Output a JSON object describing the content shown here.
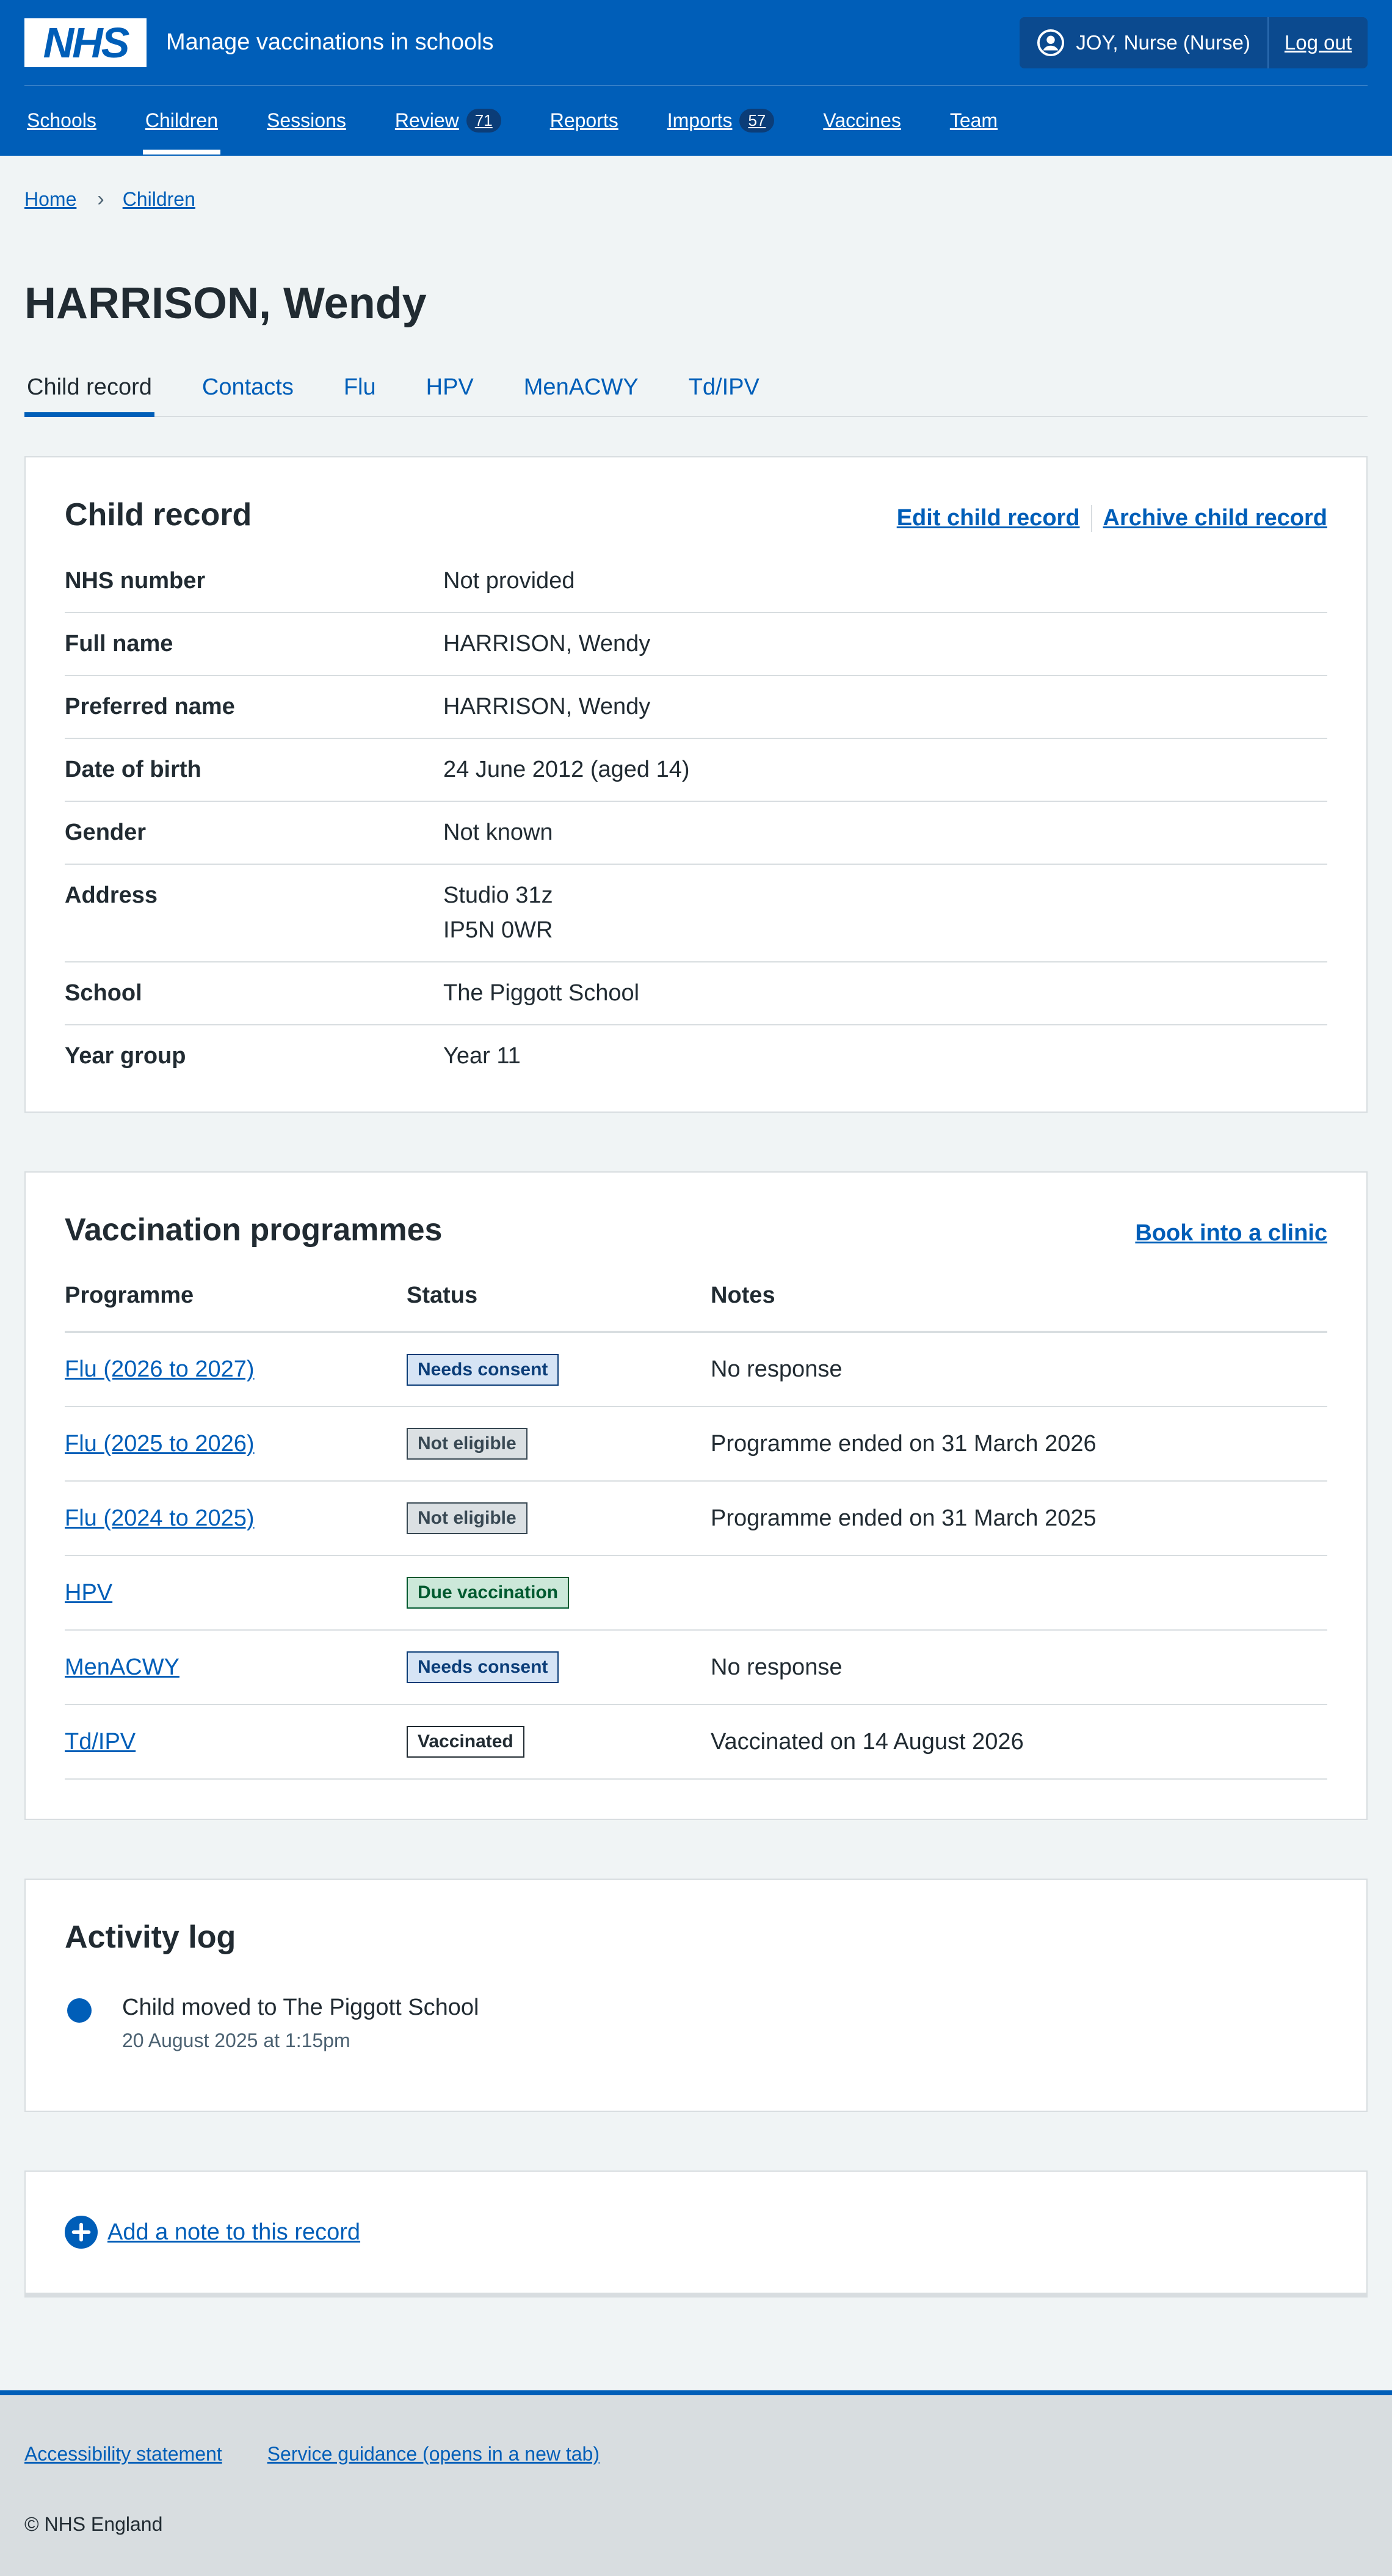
{
  "header": {
    "logo_text": "NHS",
    "service_name": "Manage vaccinations in schools",
    "user": "JOY, Nurse (Nurse)",
    "logout": "Log out"
  },
  "nav": {
    "items": [
      {
        "label": "Schools"
      },
      {
        "label": "Children",
        "active": true
      },
      {
        "label": "Sessions"
      },
      {
        "label": "Review",
        "badge": "71"
      },
      {
        "label": "Reports"
      },
      {
        "label": "Imports",
        "badge": "57"
      },
      {
        "label": "Vaccines"
      },
      {
        "label": "Team"
      }
    ]
  },
  "breadcrumb": {
    "home": "Home",
    "current": "Children"
  },
  "page_title": "HARRISON, Wendy",
  "tabs": [
    "Child record",
    "Contacts",
    "Flu",
    "HPV",
    "MenACWY",
    "Td/IPV"
  ],
  "child_record": {
    "title": "Child record",
    "edit": "Edit child record",
    "archive": "Archive child record",
    "rows": [
      {
        "key": "NHS number",
        "value": "Not provided"
      },
      {
        "key": "Full name",
        "value": "HARRISON, Wendy"
      },
      {
        "key": "Preferred name",
        "value": "HARRISON, Wendy"
      },
      {
        "key": "Date of birth",
        "value": "24 June 2012 (aged 14)"
      },
      {
        "key": "Gender",
        "value": "Not known"
      },
      {
        "key": "Address",
        "value": "Studio 31z",
        "value2": "IP5N 0WR"
      },
      {
        "key": "School",
        "value": "The Piggott School"
      },
      {
        "key": "Year group",
        "value": "Year 11"
      }
    ]
  },
  "programmes": {
    "title": "Vaccination programmes",
    "action": "Book into a clinic",
    "headers": [
      "Programme",
      "Status",
      "Notes"
    ],
    "rows": [
      {
        "programme": "Flu (2026 to 2027)",
        "status": "Needs consent",
        "notes": "No response"
      },
      {
        "programme": "Flu (2025 to 2026)",
        "status": "Not eligible",
        "notes": "Programme ended on 31 March 2026"
      },
      {
        "programme": "Flu (2024 to 2025)",
        "status": "Not eligible",
        "notes": "Programme ended on 31 March 2025"
      },
      {
        "programme": "HPV",
        "status": "Due vaccination",
        "notes": ""
      },
      {
        "programme": "MenACWY",
        "status": "Needs consent",
        "notes": "No response"
      },
      {
        "programme": "Td/IPV",
        "status": "Vaccinated",
        "notes": "Vaccinated on 14 August 2026"
      }
    ]
  },
  "activity_log": {
    "title": "Activity log",
    "entries": [
      {
        "text": "Child moved to The Piggott School",
        "time": "20 August 2025 at 1:15pm"
      }
    ]
  },
  "note": {
    "label": "Add a note to this record"
  },
  "footer": {
    "links": [
      "Accessibility statement",
      "Service guidance (opens in a new tab)"
    ],
    "copyright": "© NHS England"
  },
  "colors": {
    "brand_blue": "#005eb8",
    "tag_blue": "#d6e4f5",
    "tag_grey": "#dbe0e3",
    "tag_green": "#cce8d9"
  }
}
